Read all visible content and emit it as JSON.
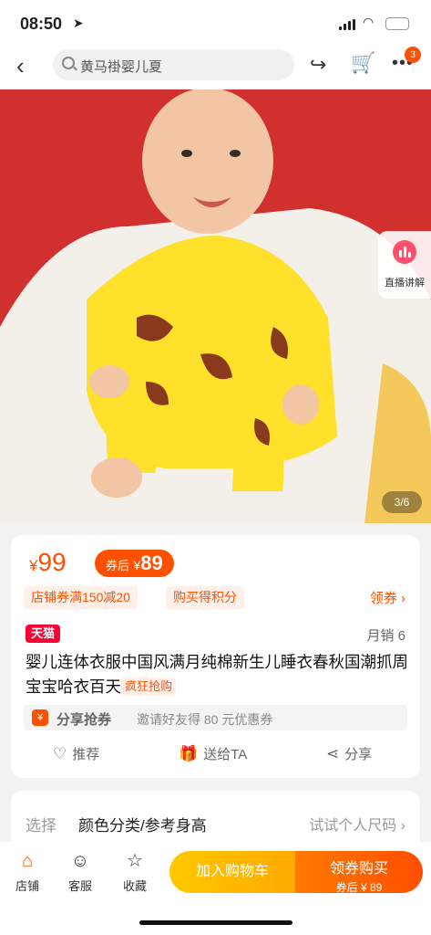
{
  "status_bar": {
    "time": "08:50",
    "location_icon": "location-arrow-icon",
    "battery_color": "#35c759"
  },
  "nav": {
    "back_icon": "back-chevron-icon",
    "search_placeholder": "黄马褂婴儿夏",
    "share_icon": "share-arrow-icon",
    "cart_icon": "cart-icon",
    "more_icon": "more-dots-icon",
    "badge": "3"
  },
  "hero": {
    "live_label": "直播讲解",
    "counter": "3/6"
  },
  "product": {
    "currency": "¥",
    "price": "99",
    "after_label": "券后",
    "after_price": "89",
    "coupons": [
      "店铺券满150减20",
      "购买得积分"
    ],
    "get_coupon": "领券",
    "brand_tag": "天猫",
    "monthly_sales": "月销 6",
    "title": "婴儿连体衣服中国风满月纯棉新生儿睡衣春秋国潮抓周宝宝哈衣百天",
    "hot_tag": "疯狂抢购",
    "share_coupon": {
      "icon_text": "¥",
      "title": "分享抢券",
      "desc": "邀请好友得 80 元优惠券"
    },
    "actions": [
      {
        "label": "推荐",
        "icon": "heart-icon"
      },
      {
        "label": "送给TA",
        "icon": "gift-icon"
      },
      {
        "label": "分享",
        "icon": "share-icon"
      }
    ]
  },
  "select": {
    "key": "选择",
    "value": "颜色分类/参考身高",
    "try_size": "试试个人尺码"
  },
  "bottom_bar": {
    "items": [
      {
        "label": "店铺",
        "icon": "store-icon"
      },
      {
        "label": "客服",
        "icon": "customer-service-icon"
      },
      {
        "label": "收藏",
        "icon": "star-icon"
      }
    ],
    "add_cart": "加入购物车",
    "buy_main": "领券购买",
    "buy_sub": "券后 ¥ 89"
  },
  "colors": {
    "accent": "#ff5000",
    "tmall": "#ff0036",
    "hero_bg": "#d22f2f"
  }
}
